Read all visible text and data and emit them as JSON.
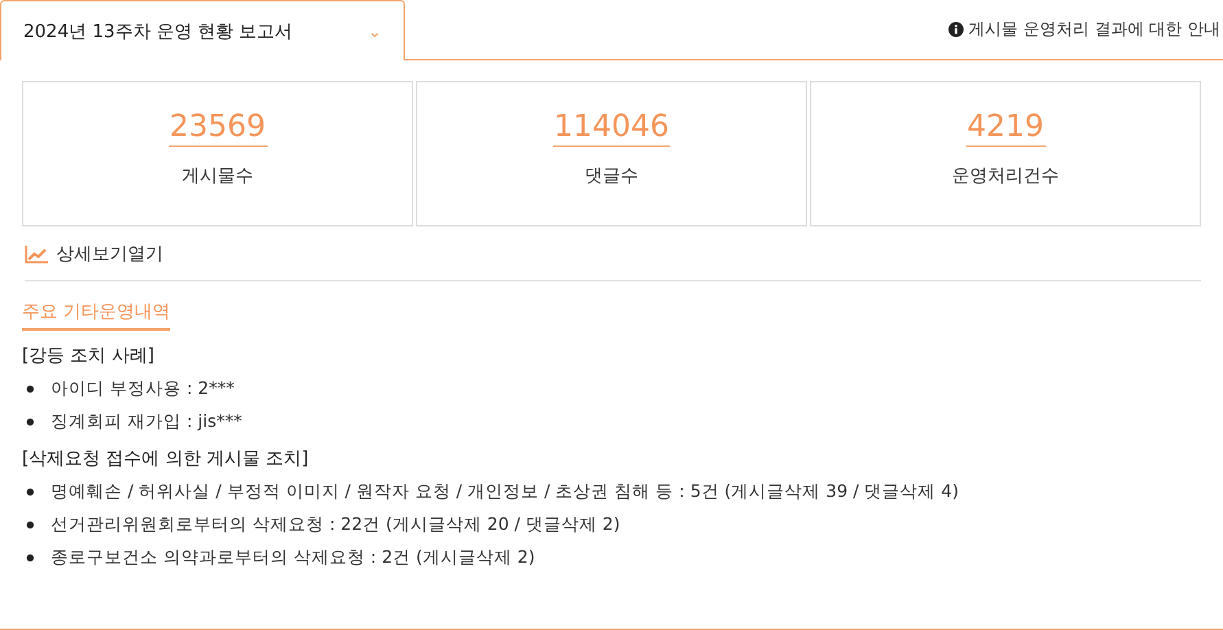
{
  "report_select": {
    "value": "2024년 13주차 운영 현황 보고서",
    "caret": "⌄"
  },
  "notice_link": {
    "label": "게시물 운영처리 결과에 대한 안내"
  },
  "stats": [
    {
      "value": "23569",
      "label": "게시물수"
    },
    {
      "value": "114046",
      "label": "댓글수"
    },
    {
      "value": "4219",
      "label": "운영처리건수"
    }
  ],
  "detail_link": {
    "label": "상세보기열기"
  },
  "section_title": "주요 기타운영내역",
  "groups": [
    {
      "heading": "[강등 조치 사례]",
      "items": [
        "아이디 부정사용 :  2***",
        "징계회피 재가입 : jis***"
      ]
    },
    {
      "heading": "[삭제요청 접수에 의한 게시물 조치]",
      "items": [
        "명예훼손 / 허위사실 / 부정적 이미지 / 원작자 요청 / 개인정보 / 초상권 침해 등 : 5건 (게시글삭제 39 / 댓글삭제 4)",
        "선거관리위원회로부터의 삭제요청 : 22건 (게시글삭제 20 / 댓글삭제 2)",
        "종로구보건소 의약과로부터의 삭제요청 : 2건 (게시글삭제 2)"
      ]
    }
  ]
}
